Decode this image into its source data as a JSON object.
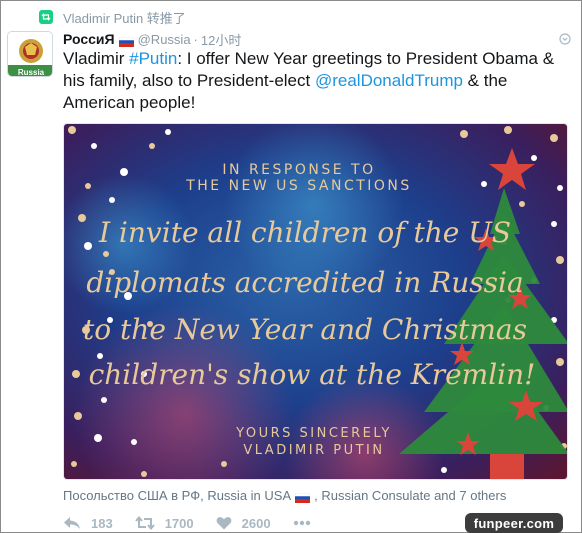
{
  "context": {
    "icon": "retweet-icon",
    "text": "Vladimir Putin 转推了"
  },
  "tweet": {
    "author_name": "РоссиЯ",
    "avatar_label": "Russia",
    "handle": "@Russia",
    "separator": "·",
    "time": "12小时",
    "text_parts": {
      "p1": "Vladimir ",
      "hashtag": "#Putin",
      "p2": ": I offer New Year greetings to President Obama & his family, also to President-elect ",
      "mention": "@realDonaldTrump",
      "p3": " & the American people!"
    },
    "image": {
      "line1": "IN RESPONSE TO",
      "line2": "THE NEW US SANCTIONS",
      "script1": "I invite all children of the US",
      "script2": "diplomats accredited in Russia",
      "script3": "to the New Year and Christmas",
      "script4": "children's show at the Kremlin!",
      "sign1": "YOURS SINCERELY",
      "sign2": "VLADIMIR PUTIN"
    },
    "mentions_line": {
      "part1": "Посольство США в РФ, Russia in USA ",
      "part2": ", Russian Consulate and 7 others"
    },
    "actions": {
      "reply_icon": "reply-icon",
      "reply_count": "183",
      "retweet_icon": "retweet-icon",
      "retweet_count": "1700",
      "like_icon": "heart-icon",
      "like_count": "2600",
      "more_icon": "more-dots-icon"
    }
  },
  "watermark": "funpeer.com",
  "colors": {
    "link": "#1b95e0",
    "retweet_green": "#19cf86",
    "muted": "#8899a6",
    "image_gold": "#e8c99a",
    "tree_green": "#2d8a3c",
    "star_red": "#d9453a"
  }
}
